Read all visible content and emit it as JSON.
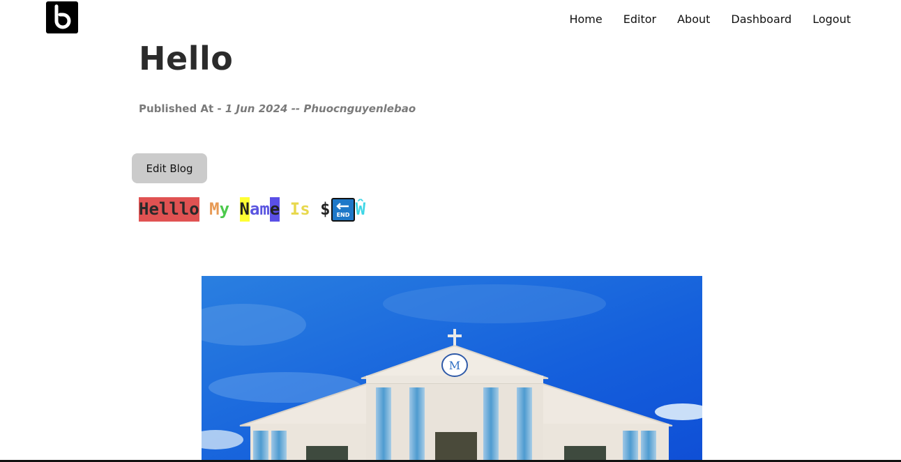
{
  "header": {
    "logo_icon": "b-logo-icon",
    "nav": [
      {
        "label": "Home"
      },
      {
        "label": "Editor"
      },
      {
        "label": "About"
      },
      {
        "label": "Dashboard"
      },
      {
        "label": "Logout"
      }
    ]
  },
  "post": {
    "title": "Hello",
    "published_prefix": "Published At - ",
    "published_date": "1 Jun 2024",
    "separator": " -- ",
    "author": "Phuocnguyenlebao",
    "edit_label": "Edit Blog"
  },
  "content": {
    "word1": "Helllo",
    "word2a": "M",
    "word2b": "y",
    "word3a": "N",
    "word3b": "am",
    "word3c": "e",
    "word4": "Is",
    "word5": "$",
    "end_icon": "end-key-icon",
    "end_label": "END",
    "word6": "Ŵ",
    "colors": {
      "red_highlight": "#e05252",
      "orange": "#e79a55",
      "green": "#4cc94c",
      "yellow_highlight": "#ffff33",
      "purple": "#5a55e0",
      "yellow": "#e8d84d",
      "cyan": "#3fd6e6",
      "end_blue": "#1e78c8"
    }
  },
  "image": {
    "subject": "church-facade-photo",
    "sky_color": "#1668e0"
  }
}
